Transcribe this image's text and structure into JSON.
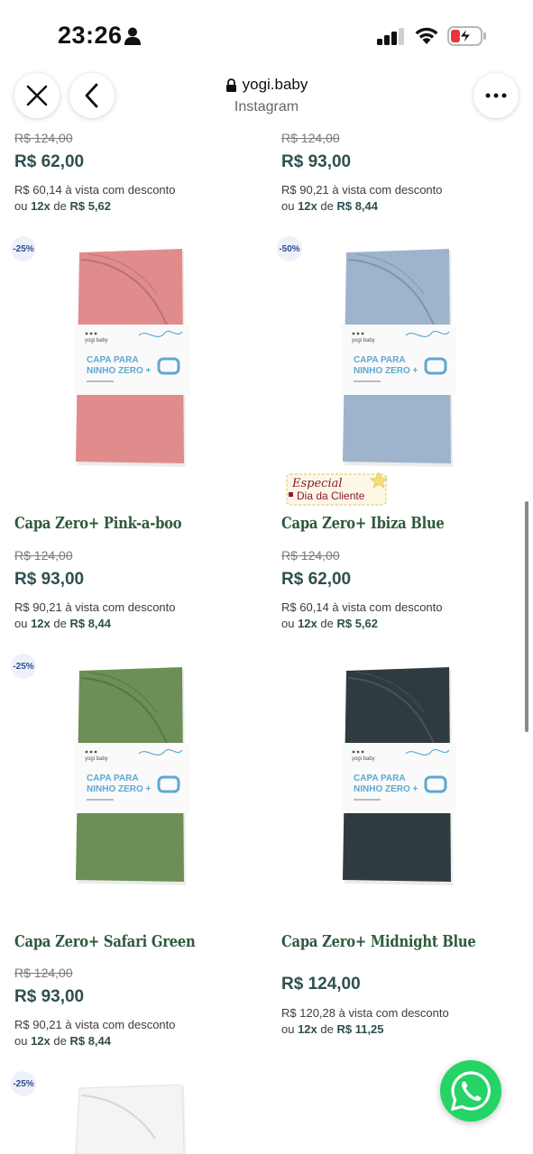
{
  "status_bar": {
    "time": "23:26"
  },
  "browser": {
    "domain": "yogi.baby",
    "source": "Instagram"
  },
  "top_row": [
    {
      "old_price": "R$ 124,00",
      "price": "R$ 62,00",
      "cash": "R$ 60,14",
      "cash_suffix": " à vista com desconto",
      "inst_prefix": "ou ",
      "inst_count": "12x",
      "inst_mid": " de ",
      "inst_value": "R$ 5,62"
    },
    {
      "old_price": "R$ 124,00",
      "price": "R$ 93,00",
      "cash": "R$ 90,21",
      "cash_suffix": " à vista com desconto",
      "inst_prefix": "ou ",
      "inst_count": "12x",
      "inst_mid": " de ",
      "inst_value": "R$ 8,44"
    }
  ],
  "products": [
    {
      "badge": "-25%",
      "color": "#e08c8c",
      "package_brand": "yogi baby",
      "package_line1": "CAPA PARA",
      "package_line2": "NINHO ZERO +",
      "title": "Capa Zero+ Pink-a-boo",
      "old_price": "R$ 124,00",
      "price": "R$ 93,00",
      "cash": "R$ 90,21",
      "cash_suffix": " à vista com desconto",
      "inst_prefix": "ou ",
      "inst_count": "12x",
      "inst_mid": " de ",
      "inst_value": "R$ 8,44"
    },
    {
      "badge": "-50%",
      "color": "#9eb4cd",
      "package_brand": "yogi baby",
      "package_line1": "CAPA PARA",
      "package_line2": "NINHO ZERO +",
      "title": "Capa Zero+ Ibiza Blue",
      "old_price": "R$ 124,00",
      "price": "R$ 62,00",
      "cash": "R$ 60,14",
      "cash_suffix": " à vista com desconto",
      "inst_prefix": "ou ",
      "inst_count": "12x",
      "inst_mid": " de ",
      "inst_value": "R$ 5,62",
      "promo_line1": "Especial",
      "promo_line2": "Dia da Cliente"
    },
    {
      "badge": "-25%",
      "color": "#6b8f55",
      "package_brand": "yogi baby",
      "package_line1": "CAPA PARA",
      "package_line2": "NINHO ZERO +",
      "title": "Capa Zero+ Safari Green",
      "old_price": "R$ 124,00",
      "price": "R$ 93,00",
      "cash": "R$ 90,21",
      "cash_suffix": " à vista com desconto",
      "inst_prefix": "ou ",
      "inst_count": "12x",
      "inst_mid": " de ",
      "inst_value": "R$ 8,44"
    },
    {
      "color": "#2f3b40",
      "package_brand": "yogi baby",
      "package_line1": "CAPA PARA",
      "package_line2": "NINHO ZERO +",
      "title": "Capa Zero+ Midnight Blue",
      "price": "R$ 124,00",
      "cash": "R$ 120,28",
      "cash_suffix": " à vista com desconto",
      "inst_prefix": "ou ",
      "inst_count": "12x",
      "inst_mid": " de ",
      "inst_value": "R$ 11,25"
    },
    {
      "badge": "-25%",
      "color": "#f4f4f4"
    }
  ]
}
